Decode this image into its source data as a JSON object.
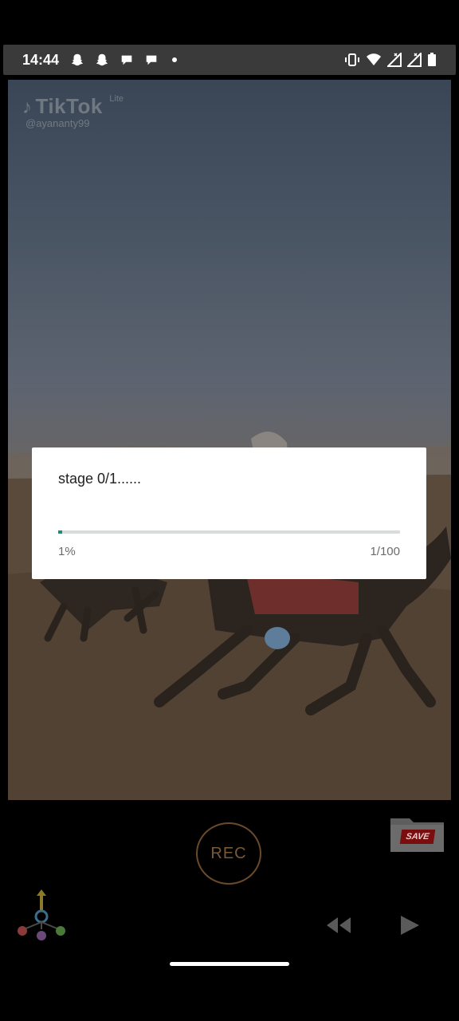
{
  "status_bar": {
    "time": "14:44",
    "left_icons": [
      "snapchat-icon",
      "snapchat-icon",
      "chat-icon",
      "chat-icon",
      "dot-icon"
    ],
    "right_icons": [
      "vibrate-icon",
      "wifi-icon",
      "signal-icon",
      "signal-icon",
      "battery-icon"
    ]
  },
  "watermark": {
    "brand": "TikTok",
    "variant": "Lite",
    "username": "@ayananty99"
  },
  "dialog": {
    "message": "stage 0/1......",
    "progress_fraction": 0.01,
    "percent_label": "1%",
    "count_label": "1/100",
    "accent_color": "#1a8c7a"
  },
  "controls": {
    "rec_label": "REC",
    "save_label": "SAVE",
    "rec_color": "#7a5838",
    "save_color": "#7a0e0e"
  }
}
